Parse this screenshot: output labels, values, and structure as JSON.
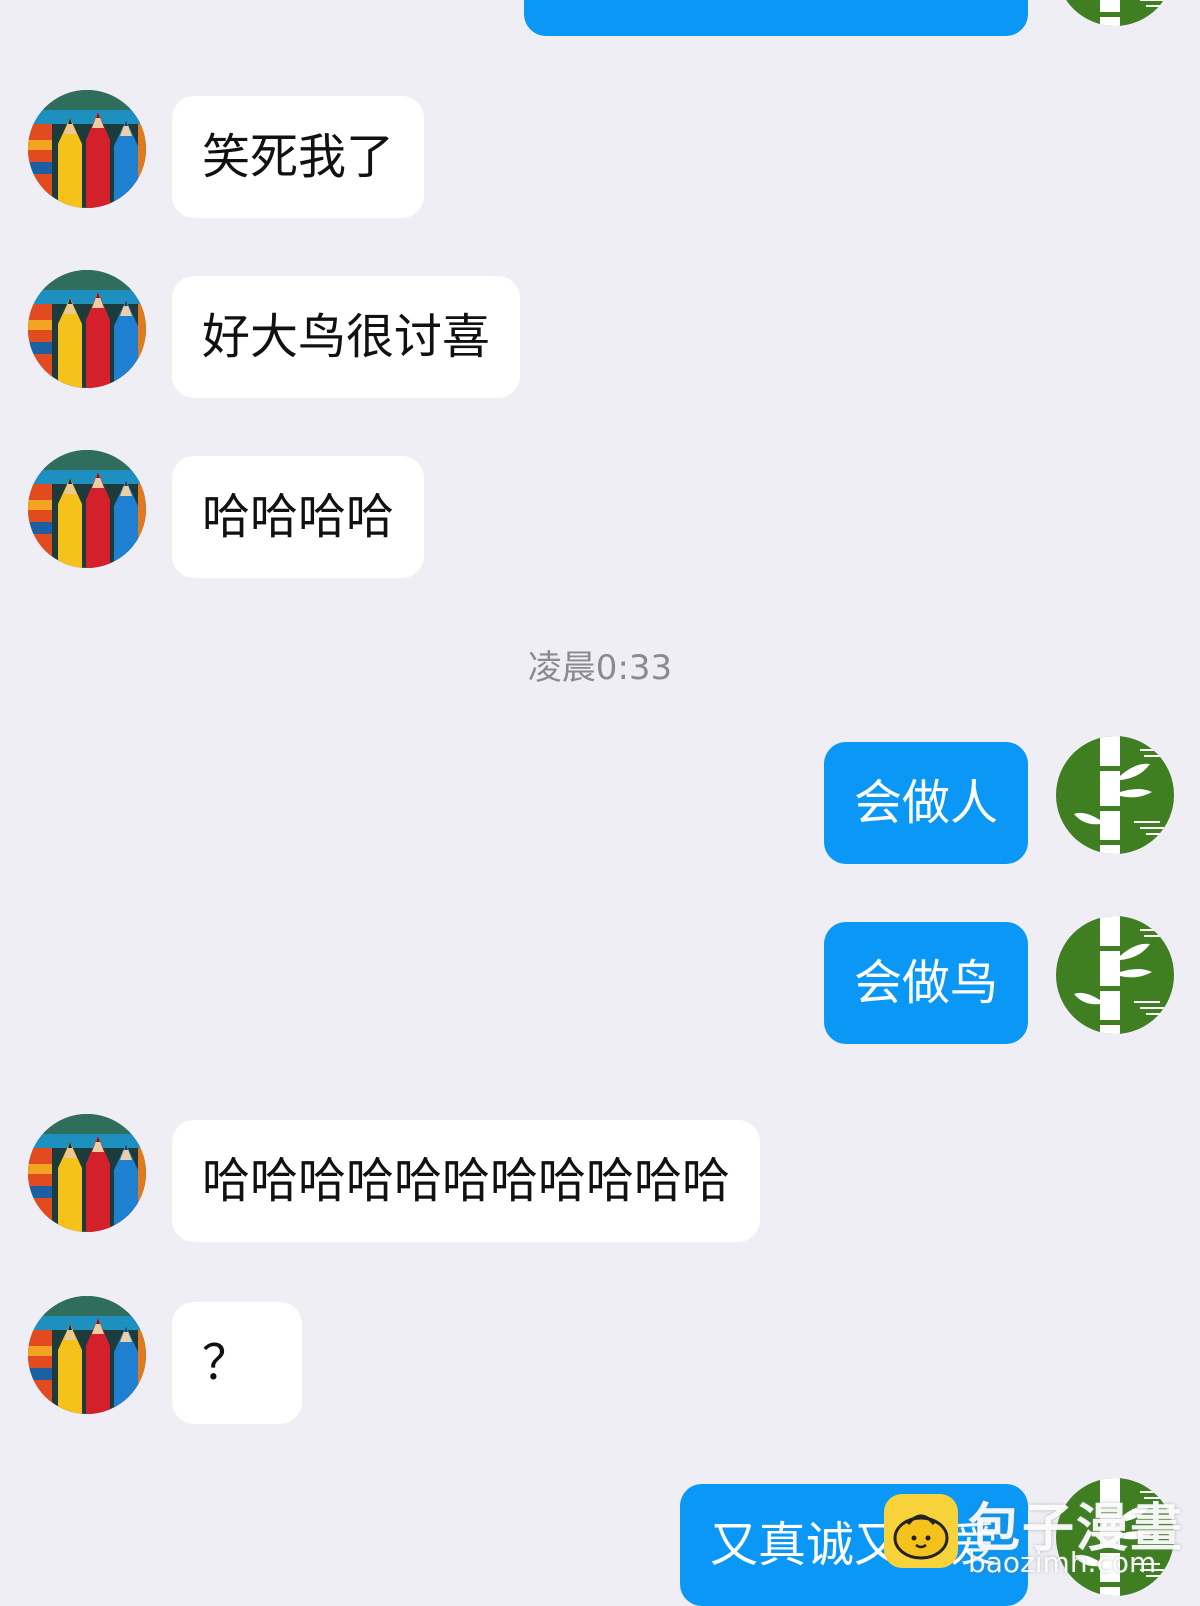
{
  "timestamp": "凌晨0:33",
  "messages": [
    {
      "side": "out",
      "text": "",
      "avatar": "bamboo-avatar"
    },
    {
      "side": "in",
      "text": "笑死我了",
      "avatar": "pencils-avatar"
    },
    {
      "side": "in",
      "text": "好大鸟很讨喜",
      "avatar": "pencils-avatar"
    },
    {
      "side": "in",
      "text": "哈哈哈哈",
      "avatar": "pencils-avatar"
    },
    {
      "side": "out",
      "text": "会做人",
      "avatar": "bamboo-avatar"
    },
    {
      "side": "out",
      "text": "会做鸟",
      "avatar": "bamboo-avatar"
    },
    {
      "side": "in",
      "text": "哈哈哈哈哈哈哈哈哈哈哈",
      "avatar": "pencils-avatar"
    },
    {
      "side": "in",
      "text": "？",
      "avatar": "pencils-avatar"
    },
    {
      "side": "out",
      "text": "又真诚又可爱",
      "avatar": "bamboo-avatar"
    }
  ],
  "watermark": {
    "title": "包子漫畫",
    "url": "baozimh.com"
  },
  "colors": {
    "background": "#eeeef4",
    "outgoing_bubble": "#0a97f5",
    "incoming_bubble": "#ffffff",
    "timestamp_text": "#8b8b8f"
  }
}
